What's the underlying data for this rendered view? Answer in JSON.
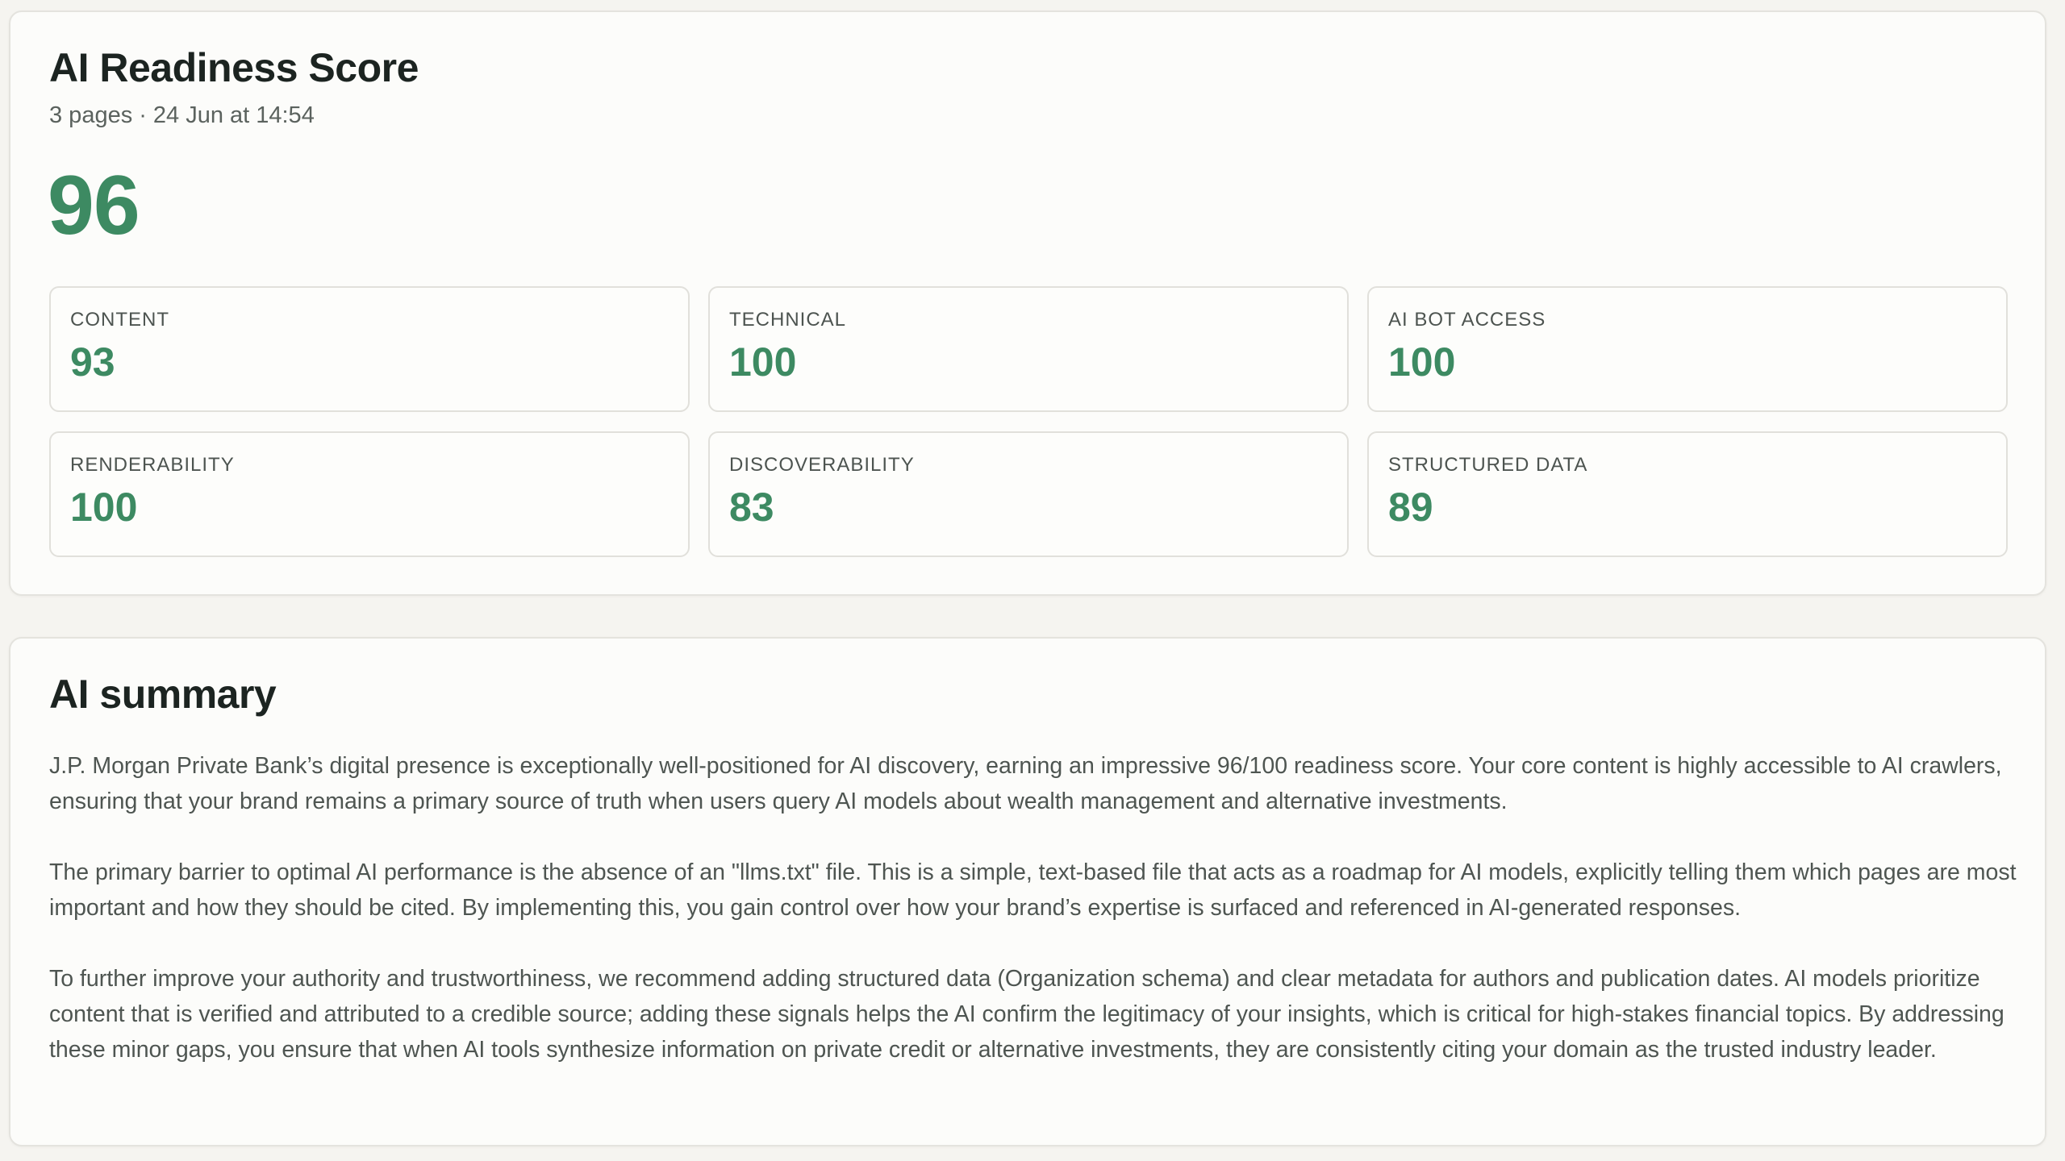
{
  "score_card": {
    "title": "AI Readiness Score",
    "pages": "3 pages",
    "separator": "·",
    "date": "24 Jun at 14:54",
    "overall_score": "96",
    "metrics": [
      {
        "label": "CONTENT",
        "value": "93"
      },
      {
        "label": "TECHNICAL",
        "value": "100"
      },
      {
        "label": "AI BOT ACCESS",
        "value": "100"
      },
      {
        "label": "RENDERABILITY",
        "value": "100"
      },
      {
        "label": "DISCOVERABILITY",
        "value": "83"
      },
      {
        "label": "STRUCTURED DATA",
        "value": "89"
      }
    ]
  },
  "summary_card": {
    "title": "AI summary",
    "paragraphs": [
      "J.P. Morgan Private Bank’s digital presence is exceptionally well-positioned for AI discovery, earning an impressive 96/100 readiness score. Your core content is highly accessible to AI crawlers, ensuring that your brand remains a primary source of truth when users query AI models about wealth management and alternative investments.",
      "The primary barrier to optimal AI performance is the absence of an \"llms.txt\" file. This is a simple, text-based file that acts as a roadmap for AI models, explicitly telling them which pages are most important and how they should be cited. By implementing this, you gain control over how your brand’s expertise is surfaced and referenced in AI-generated responses.",
      "To further improve your authority and trustworthiness, we recommend adding structured data (Organization schema) and clear metadata for authors and publication dates. AI models prioritize content that is verified and attributed to a credible source; adding these signals helps the AI confirm the legitimacy of your insights, which is critical for high-stakes financial topics.  By addressing these minor gaps, you ensure that when AI tools synthesize information on private credit or alternative investments, they are consistently citing your domain as the trusted industry leader."
    ]
  },
  "colors": {
    "accent_green": "#3d8a62",
    "background": "#f5f4f0",
    "card": "#fcfcfa"
  }
}
